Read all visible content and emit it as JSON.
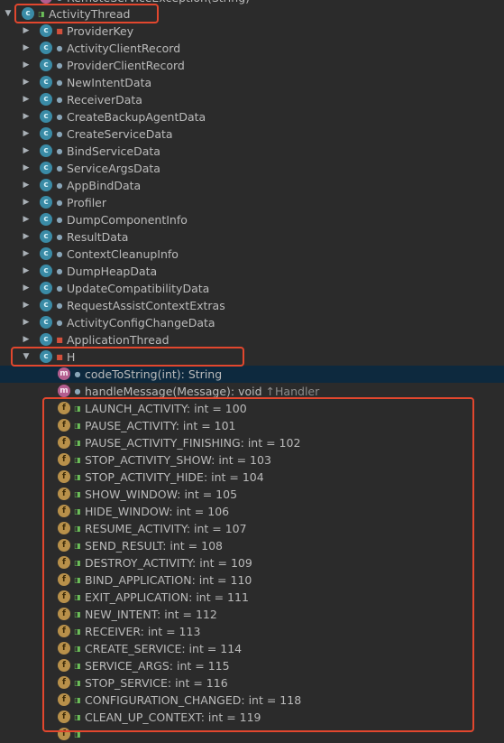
{
  "top_partial": "RemoteServiceException(String)",
  "activity_thread": "ActivityThread",
  "classes": [
    {
      "name": "ProviderKey",
      "vis": "priv"
    },
    {
      "name": "ActivityClientRecord",
      "vis": "pkg"
    },
    {
      "name": "ProviderClientRecord",
      "vis": "pkg"
    },
    {
      "name": "NewIntentData",
      "vis": "pkg"
    },
    {
      "name": "ReceiverData",
      "vis": "pkg"
    },
    {
      "name": "CreateBackupAgentData",
      "vis": "pkg"
    },
    {
      "name": "CreateServiceData",
      "vis": "pkg"
    },
    {
      "name": "BindServiceData",
      "vis": "pkg"
    },
    {
      "name": "ServiceArgsData",
      "vis": "pkg"
    },
    {
      "name": "AppBindData",
      "vis": "pkg"
    },
    {
      "name": "Profiler",
      "vis": "pkg"
    },
    {
      "name": "DumpComponentInfo",
      "vis": "pkg"
    },
    {
      "name": "ResultData",
      "vis": "pkg"
    },
    {
      "name": "ContextCleanupInfo",
      "vis": "pkg"
    },
    {
      "name": "DumpHeapData",
      "vis": "pkg"
    },
    {
      "name": "UpdateCompatibilityData",
      "vis": "pkg"
    },
    {
      "name": "RequestAssistContextExtras",
      "vis": "pkg"
    },
    {
      "name": "ActivityConfigChangeData",
      "vis": "pkg"
    },
    {
      "name": "ApplicationThread",
      "vis": "priv"
    }
  ],
  "h_class": "H",
  "methods": [
    {
      "name": "codeToString(int): String",
      "hint": ""
    },
    {
      "name": "handleMessage(Message): void",
      "hint": "↑Handler"
    }
  ],
  "fields": [
    "LAUNCH_ACTIVITY: int = 100",
    "PAUSE_ACTIVITY: int = 101",
    "PAUSE_ACTIVITY_FINISHING: int = 102",
    "STOP_ACTIVITY_SHOW: int = 103",
    "STOP_ACTIVITY_HIDE: int = 104",
    "SHOW_WINDOW: int = 105",
    "HIDE_WINDOW: int = 106",
    "RESUME_ACTIVITY: int = 107",
    "SEND_RESULT: int = 108",
    "DESTROY_ACTIVITY: int = 109",
    "BIND_APPLICATION: int = 110",
    "EXIT_APPLICATION: int = 111",
    "NEW_INTENT: int = 112",
    "RECEIVER: int = 113",
    "CREATE_SERVICE: int = 114",
    "SERVICE_ARGS: int = 115",
    "STOP_SERVICE: int = 116",
    "CONFIGURATION_CHANGED: int = 118",
    "CLEAN_UP_CONTEXT: int = 119"
  ],
  "icons": {
    "expanded": "triangle-down",
    "collapsed": "triangle-right",
    "class": "class-icon",
    "method": "method-icon",
    "field": "field-icon"
  },
  "colors": {
    "background": "#2b2b2b",
    "selected_row": "#0d293e",
    "highlight_box": "#e2472e",
    "class_badge": "#3a8ba6",
    "method_badge": "#b35d8e",
    "field_badge": "#b8904a"
  }
}
